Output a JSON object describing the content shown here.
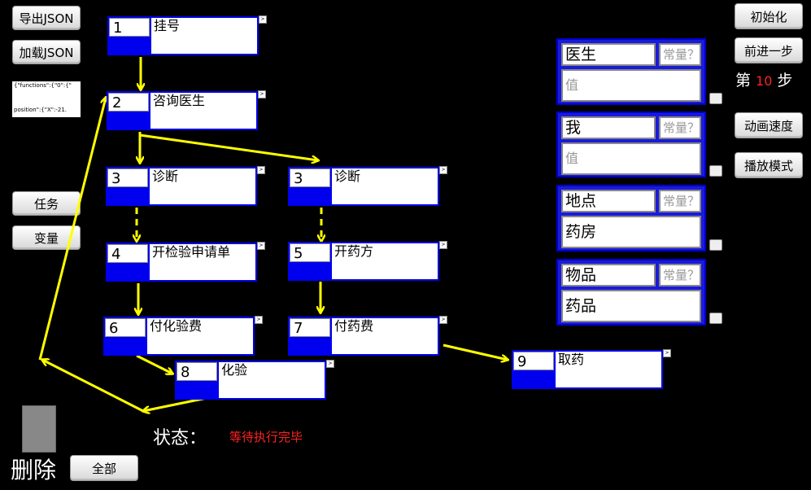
{
  "toolbar_left": {
    "export_json": "导出JSON",
    "load_json": "加载JSON",
    "json_preview_line1": "{\"functions\":{\"0\":{\"",
    "json_preview_line2": "position\":{\"X\":-21.",
    "tasks": "任务",
    "variables": "变量"
  },
  "toolbar_right": {
    "init": "初始化",
    "step_forward": "前进一步",
    "step_prefix": "第",
    "step_number": "10",
    "step_suffix": "步",
    "animation_speed": "动画速度",
    "play_mode": "播放模式"
  },
  "nodes": [
    {
      "num": "1",
      "title": "挂号"
    },
    {
      "num": "2",
      "title": "咨询医生"
    },
    {
      "num": "3",
      "title": "诊断"
    },
    {
      "num": "3",
      "title": "诊断"
    },
    {
      "num": "4",
      "title": "开检验申请单"
    },
    {
      "num": "5",
      "title": "开药方"
    },
    {
      "num": "6",
      "title": "付化验费"
    },
    {
      "num": "7",
      "title": "付药费"
    },
    {
      "num": "8",
      "title": "化验"
    },
    {
      "num": "9",
      "title": "取药"
    }
  ],
  "node_expand_glyph": ">",
  "variables": [
    {
      "name": "医生",
      "kind": "常量？",
      "value": "值"
    },
    {
      "name": "我",
      "kind": "常量？",
      "value": "值"
    },
    {
      "name": "地点",
      "kind": "常量？",
      "value": "药房"
    },
    {
      "name": "物品",
      "kind": "常量？",
      "value": "药品"
    }
  ],
  "status": {
    "label": "状态：",
    "value": "等待执行完毕"
  },
  "delete": {
    "label": "删除",
    "all_button": "全部"
  },
  "colors": {
    "background": "#000000",
    "node_border": "#0000ee",
    "arrow": "#ffff00",
    "status_value": "#ff2222",
    "step_number": "#ff2222"
  }
}
